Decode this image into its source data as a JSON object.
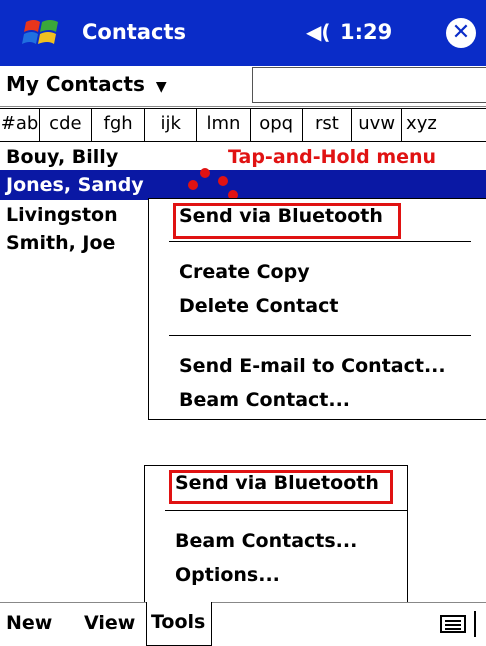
{
  "titlebar": {
    "title": "Contacts",
    "volume_icon": "speaker-icon",
    "time": "1:29",
    "close": "✕"
  },
  "filter": {
    "label": "My Contacts",
    "dropdown_arrow": "▼",
    "search_value": ""
  },
  "tabs": [
    "#ab",
    "cde",
    "fgh",
    "ijk",
    "lmn",
    "opq",
    "rst",
    "uvw",
    "xyz"
  ],
  "contacts": [
    "Bouy, Billy",
    "Jones, Sandy",
    "Livingston",
    "Smith, Joe"
  ],
  "annotation": "Tap-and-Hold menu",
  "context_menu": {
    "send_bluetooth": "Send via Bluetooth",
    "create_copy": "Create Copy",
    "delete_contact": "Delete Contact",
    "send_email": "Send E-mail to Contact...",
    "beam_contact": "Beam Contact..."
  },
  "tools_menu": {
    "send_bluetooth": "Send via Bluetooth",
    "beam_contacts": "Beam Contacts...",
    "options": "Options..."
  },
  "bottom_bar": {
    "new": "New",
    "view": "View",
    "tools": "Tools",
    "keyboard_icon": "keyboard-icon"
  },
  "colors": {
    "titlebar": "#0a2cc8",
    "selection": "#0a18a4",
    "highlight": "#e01212"
  }
}
